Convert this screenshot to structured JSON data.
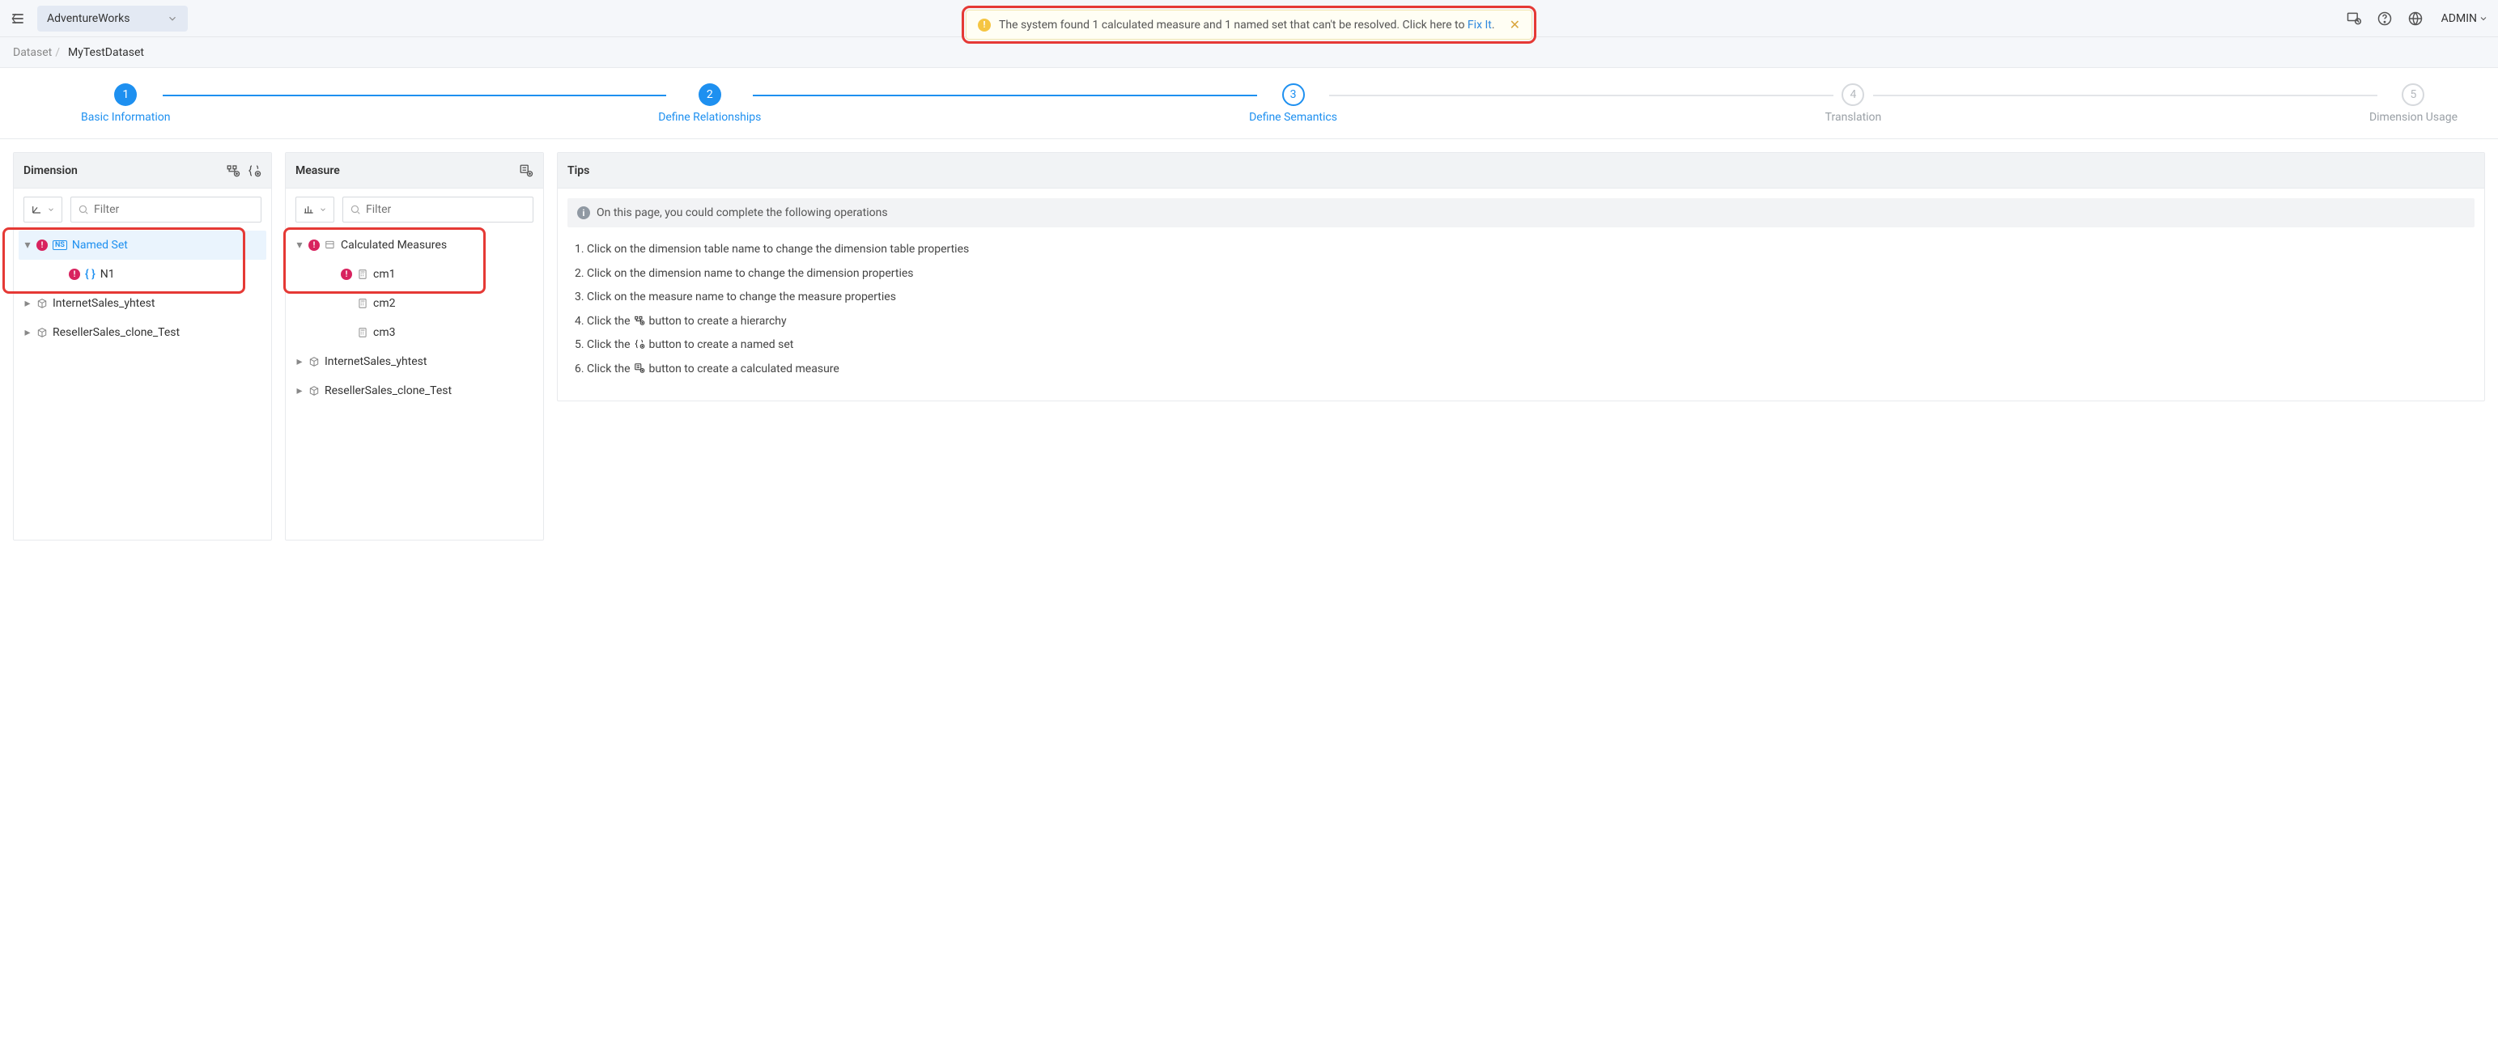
{
  "topbar": {
    "project": "AdventureWorks",
    "admin": "ADMIN"
  },
  "alert": {
    "text_prefix": "The system found 1 calculated measure and 1 named set that can't be resolved. Click here to ",
    "link": "Fix It",
    "text_suffix": "."
  },
  "breadcrumb": {
    "root": "Dataset",
    "current": "MyTestDataset"
  },
  "wizard": {
    "s1": "Basic Information",
    "s2": "Define Relationships",
    "s3": "Define Semantics",
    "s4": "Translation",
    "s5": "Dimension Usage"
  },
  "dim": {
    "title": "Dimension",
    "filter_ph": "Filter",
    "named_set": "Named Set",
    "n1": "N1",
    "i1": "InternetSales_yhtest",
    "i2": "ResellerSales_clone_Test"
  },
  "mea": {
    "title": "Measure",
    "filter_ph": "Filter",
    "calc": "Calculated Measures",
    "c1": "cm1",
    "c2": "cm2",
    "c3": "cm3",
    "i1": "InternetSales_yhtest",
    "i2": "ResellerSales_clone_Test"
  },
  "tips": {
    "title": "Tips",
    "lead": "On this page, you could complete the following operations",
    "t1": "Click on the dimension table name to change the dimension table properties",
    "t2": "Click on the dimension name to change the dimension properties",
    "t3": "Click on the measure name to change the measure properties",
    "t4a": "Click the ",
    "t4b": " button to create a hierarchy",
    "t5a": "Click the ",
    "t5b": " button to create a named set",
    "t6a": "Click the ",
    "t6b": " button to create a calculated measure"
  }
}
